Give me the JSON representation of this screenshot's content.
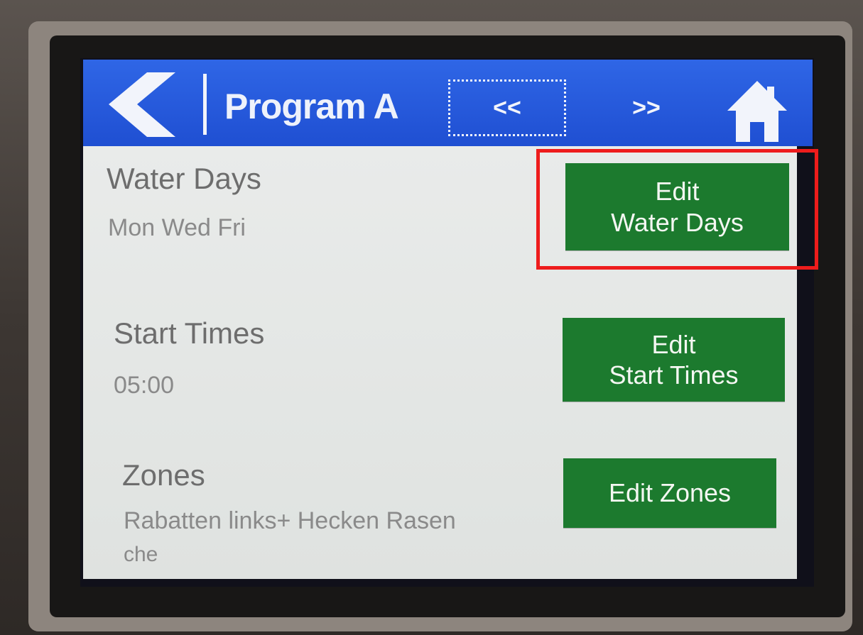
{
  "header": {
    "title": "Program A",
    "prev_label": "<<",
    "next_label": ">>"
  },
  "sections": {
    "water_days": {
      "label": "Water Days",
      "value": "Mon Wed Fri",
      "button_line1": "Edit",
      "button_line2": "Water Days"
    },
    "start_times": {
      "label": "Start Times",
      "value": "05:00",
      "button_line1": "Edit",
      "button_line2": "Start Times"
    },
    "zones": {
      "label": "Zones",
      "value_line1": "Rabatten links+ Hecken Rasen",
      "value_line2": "che",
      "button_label": "Edit Zones"
    }
  },
  "icons": {
    "back": "chevron-left-icon",
    "home": "home-icon"
  },
  "colors": {
    "header_blue": "#2458dc",
    "button_green": "#1c7a2e",
    "highlight_red": "#ee1c1c",
    "content_bg": "#e6e8e7"
  }
}
